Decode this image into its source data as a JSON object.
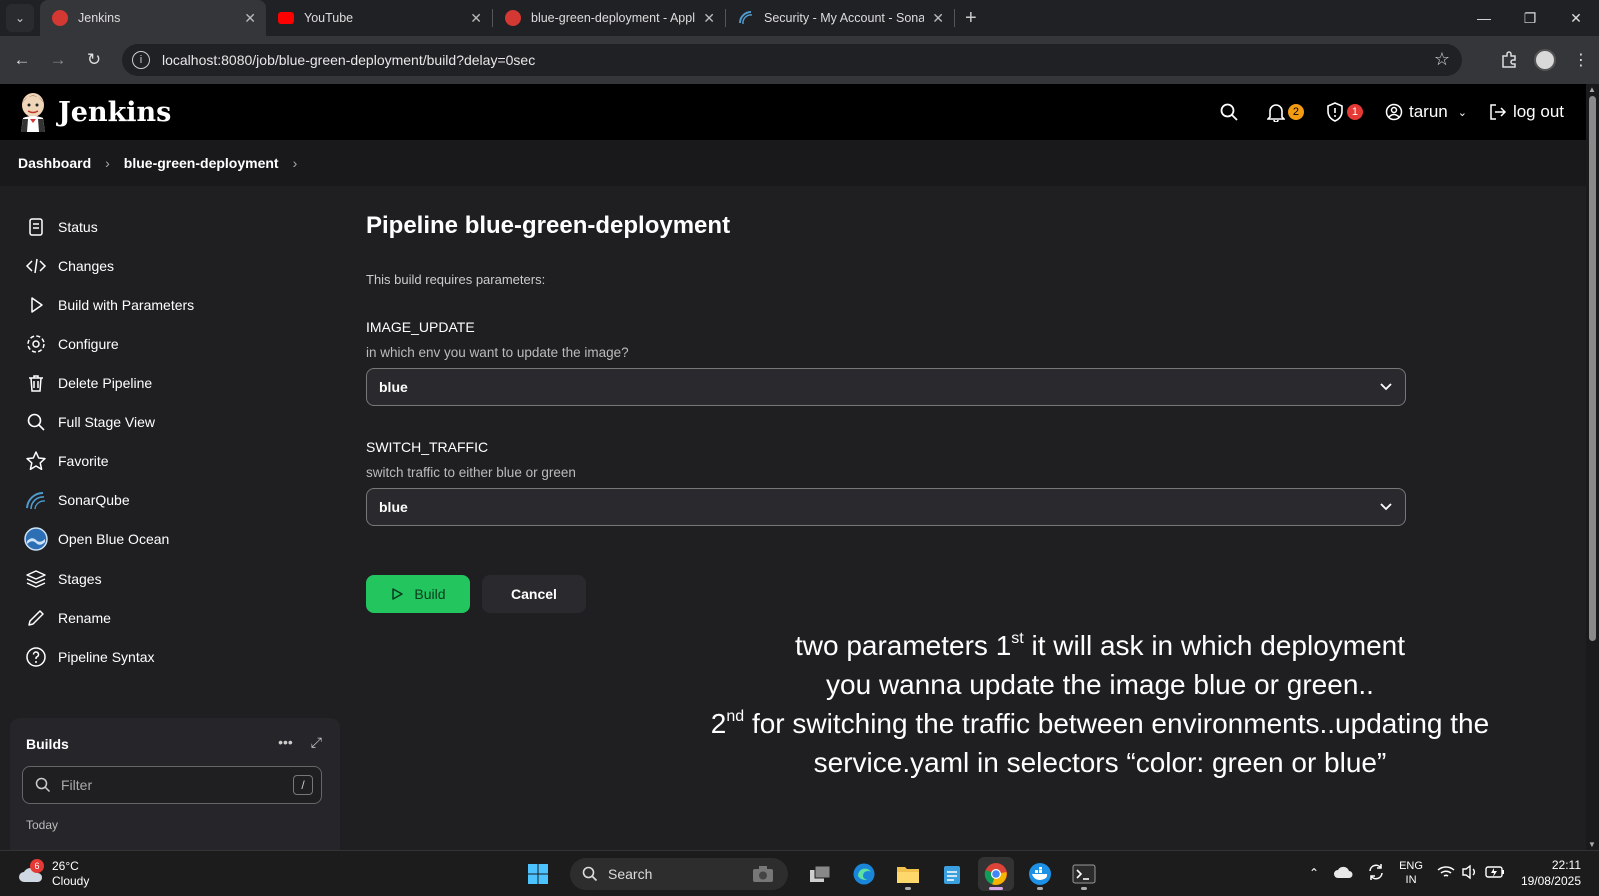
{
  "browser": {
    "tabs": [
      {
        "title": "Jenkins",
        "active": true,
        "favicon_color": "#d33833"
      },
      {
        "title": "YouTube",
        "active": false,
        "favicon_color": "#ff0000"
      },
      {
        "title": "blue-green-deployment - Appli",
        "active": false,
        "favicon_color": "#d33833"
      },
      {
        "title": "Security - My Account - SonarQ",
        "active": false,
        "favicon_color": "#4e9bcd"
      }
    ],
    "url": "localhost:8080/job/blue-green-deployment/build?delay=0sec"
  },
  "header": {
    "app_title": "Jenkins",
    "notifications_count": "2",
    "security_count": "1",
    "user": "tarun",
    "logout_label": "log out"
  },
  "breadcrumb": [
    "Dashboard",
    "blue-green-deployment"
  ],
  "sidebar": {
    "items": [
      {
        "label": "Status",
        "icon": "document-icon"
      },
      {
        "label": "Changes",
        "icon": "code-icon"
      },
      {
        "label": "Build with Parameters",
        "icon": "play-icon"
      },
      {
        "label": "Configure",
        "icon": "gear-icon"
      },
      {
        "label": "Delete Pipeline",
        "icon": "trash-icon"
      },
      {
        "label": "Full Stage View",
        "icon": "search-icon"
      },
      {
        "label": "Favorite",
        "icon": "star-icon"
      },
      {
        "label": "SonarQube",
        "icon": "sonarqube-icon"
      },
      {
        "label": "Open Blue Ocean",
        "icon": "blue-ocean-icon"
      },
      {
        "label": "Stages",
        "icon": "layers-icon"
      },
      {
        "label": "Rename",
        "icon": "pencil-icon"
      },
      {
        "label": "Pipeline Syntax",
        "icon": "help-icon"
      }
    ],
    "builds": {
      "title": "Builds",
      "filter_placeholder": "Filter",
      "filter_shortcut": "/",
      "group_label": "Today"
    }
  },
  "main": {
    "title": "Pipeline blue-green-deployment",
    "requires_text": "This build requires parameters:",
    "params": [
      {
        "name": "IMAGE_UPDATE",
        "description": "in which env you want to update the image?",
        "value": "blue"
      },
      {
        "name": "SWITCH_TRAFFIC",
        "description": "switch traffic to either blue or green",
        "value": "blue"
      }
    ],
    "build_label": "Build",
    "cancel_label": "Cancel"
  },
  "annotation": {
    "line1_pre": "two parameters 1",
    "line1_sup": "st",
    "line1_post": " it will ask in which deployment",
    "line2": "you wanna update the image blue or green..",
    "line3_pre": "2",
    "line3_sup": "nd",
    "line3_post": " for switching the traffic between environments..updating the",
    "line4": "service.yaml in selectors “color: green or blue”"
  },
  "taskbar": {
    "weather_temp": "26°C",
    "weather_desc": "Cloudy",
    "weather_badge": "6",
    "search_label": "Search",
    "lang_top": "ENG",
    "lang_bottom": "IN",
    "time": "22:11",
    "date": "19/08/2025"
  },
  "colors": {
    "jenkins_header": "#000000",
    "build_button": "#22c55e",
    "page_background": "#1f1f22"
  }
}
